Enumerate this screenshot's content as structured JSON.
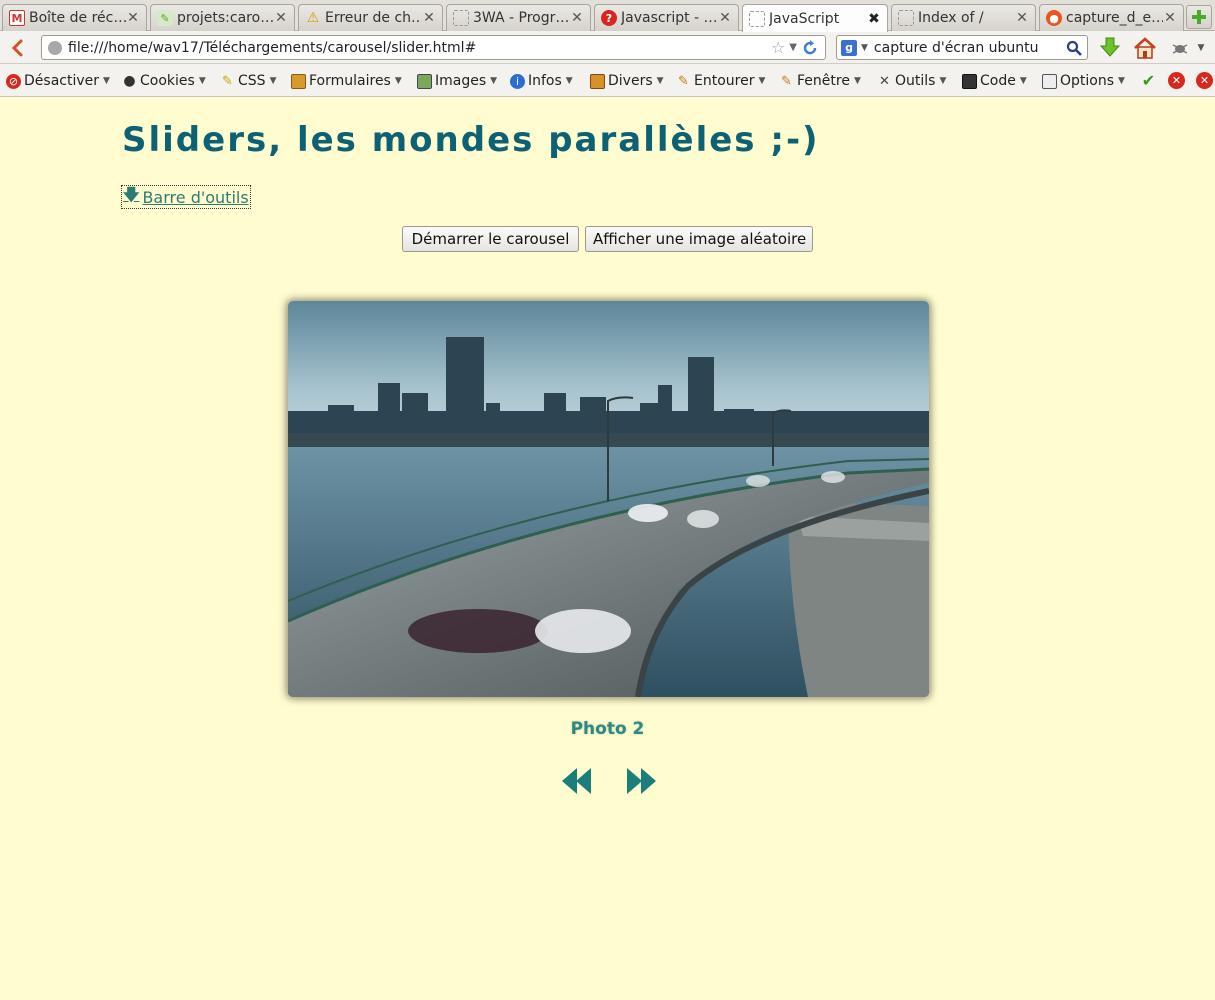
{
  "browser": {
    "tabs": [
      {
        "title": "Boîte de réc…",
        "icon": "gmail-icon",
        "active": false
      },
      {
        "title": "projets:caro…",
        "icon": "wiki-icon",
        "active": false
      },
      {
        "title": "Erreur de ch…",
        "icon": "warning-icon",
        "active": false
      },
      {
        "title": "3WA - Progr…",
        "icon": "blank-page-icon",
        "active": false
      },
      {
        "title": "Javascript - …",
        "icon": "help-icon",
        "active": false
      },
      {
        "title": "JavaScript",
        "icon": "blank-page-icon",
        "active": true
      },
      {
        "title": "Index of /",
        "icon": "blank-page-icon",
        "active": false
      },
      {
        "title": "capture_d_e…",
        "icon": "ubuntu-icon",
        "active": false
      }
    ],
    "url": "file:///home/wav17/Téléchargements/carousel/slider.html#",
    "search_value": "capture d'écran ubuntu"
  },
  "devtoolbar": {
    "items": [
      {
        "label": "Désactiver",
        "icon": "disable-icon"
      },
      {
        "label": "Cookies",
        "icon": "cookies-icon"
      },
      {
        "label": "CSS",
        "icon": "css-icon"
      },
      {
        "label": "Formulaires",
        "icon": "forms-icon"
      },
      {
        "label": "Images",
        "icon": "images-icon"
      },
      {
        "label": "Infos",
        "icon": "info-icon"
      },
      {
        "label": "Divers",
        "icon": "misc-icon"
      },
      {
        "label": "Entourer",
        "icon": "outline-icon"
      },
      {
        "label": "Fenêtre",
        "icon": "resize-icon"
      },
      {
        "label": "Outils",
        "icon": "tools-icon"
      },
      {
        "label": "Code",
        "icon": "source-icon"
      },
      {
        "label": "Options",
        "icon": "options-icon"
      }
    ]
  },
  "page": {
    "title": "Sliders, les mondes parallèles ;-)",
    "toolbar_toggle": "Barre d'outils",
    "start_button": "Démarrer le carousel",
    "random_button": "Afficher une image aléatoire",
    "caption": "Photo 2"
  },
  "colors": {
    "page_background": "#fffdd0",
    "title": "#0c6175",
    "accent": "#2a8a86"
  }
}
